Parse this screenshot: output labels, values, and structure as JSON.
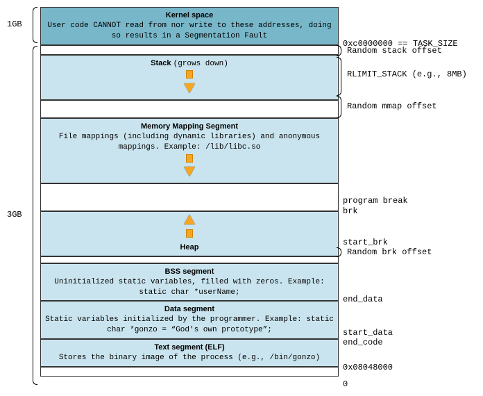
{
  "left": {
    "top_size": "1GB",
    "bottom_size": "3GB"
  },
  "segments": {
    "kernel": {
      "title": "Kernel space",
      "desc": "User code CANNOT read from nor write to these addresses, doing so results in a Segmentation Fault"
    },
    "stack": {
      "title": "Stack",
      "note": "(grows down)"
    },
    "mmap": {
      "title": "Memory Mapping Segment",
      "desc": "File mappings (including dynamic libraries) and anonymous mappings. Example: /lib/libc.so"
    },
    "heap": {
      "title": "Heap"
    },
    "bss": {
      "title": "BSS segment",
      "desc": "Uninitialized static variables, filled with zeros. Example: static char *userName;"
    },
    "data": {
      "title": "Data segment",
      "desc": "Static variables initialized by the programmer. Example: static char *gonzo = “God's own prototype”;"
    },
    "text": {
      "title": "Text segment (ELF)",
      "desc": "Stores the binary image of the process (e.g., /bin/gonzo)"
    }
  },
  "right": {
    "task_size": "0xc0000000 == TASK_SIZE",
    "rand_stack": "Random stack offset",
    "rlimit": "RLIMIT_STACK (e.g., 8MB)",
    "rand_mmap": "Random mmap offset",
    "pbreak": "program break",
    "brk": "brk",
    "start_brk": "start_brk",
    "rand_brk": "Random brk offset",
    "end_data": "end_data",
    "start_data": "start_data",
    "end_code": "end_code",
    "addr": "0x08048000",
    "zero": "0"
  }
}
